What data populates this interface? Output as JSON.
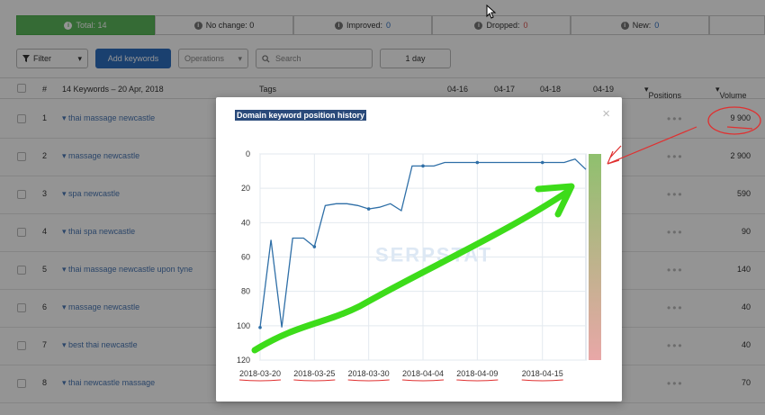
{
  "summary": {
    "total": "Total: 14",
    "no_change": "No change: 0",
    "improved_label": "Improved:",
    "improved_value": "0",
    "dropped_label": "Dropped:",
    "dropped_value": "0",
    "new_label": "New:",
    "new_value": "0"
  },
  "toolbar": {
    "filter": "Filter",
    "add_keywords": "Add keywords",
    "operations": "Operations",
    "search_placeholder": "Search",
    "period": "1 day"
  },
  "table": {
    "headers": {
      "num": "#",
      "keywords": "14 Keywords – 20 Apr, 2018",
      "tags": "Tags",
      "d1": "04-16",
      "d2": "04-17",
      "d3": "04-18",
      "d4": "04-19",
      "positions": "Positions",
      "volume": "Volume"
    },
    "rows": [
      {
        "idx": "1",
        "keyword": "thai massage newcastle",
        "volume": "9 900"
      },
      {
        "idx": "2",
        "keyword": "massage newcastle",
        "volume": "2 900"
      },
      {
        "idx": "3",
        "keyword": "spa newcastle",
        "volume": "590"
      },
      {
        "idx": "4",
        "keyword": "thai spa newcastle",
        "volume": "90"
      },
      {
        "idx": "5",
        "keyword": "thai massage newcastle upon tyne",
        "volume": "140"
      },
      {
        "idx": "6",
        "keyword": "massage newcastle",
        "volume": "40"
      },
      {
        "idx": "7",
        "keyword": "best thai newcastle",
        "volume": "40"
      },
      {
        "idx": "8",
        "keyword": "thai newcastle massage",
        "volume": "70"
      }
    ]
  },
  "modal": {
    "title": "Domain keyword position history",
    "close": "×",
    "watermark": "SERPSTAT"
  },
  "chart_data": {
    "type": "line",
    "title": "Domain keyword position history",
    "xlabel": "",
    "ylabel": "",
    "x_ticks": [
      "2018-03-20",
      "2018-03-25",
      "2018-03-30",
      "2018-04-04",
      "2018-04-09",
      "2018-04-15"
    ],
    "y_ticks": [
      0,
      20,
      40,
      60,
      80,
      100,
      120
    ],
    "ylim": [
      120,
      0
    ],
    "y_inverted": true,
    "grid": true,
    "x": [
      "2018-03-20",
      "2018-03-21",
      "2018-03-22",
      "2018-03-23",
      "2018-03-24",
      "2018-03-25",
      "2018-03-26",
      "2018-03-27",
      "2018-03-28",
      "2018-03-29",
      "2018-03-30",
      "2018-03-31",
      "2018-04-01",
      "2018-04-02",
      "2018-04-03",
      "2018-04-04",
      "2018-04-05",
      "2018-04-06",
      "2018-04-07",
      "2018-04-08",
      "2018-04-09",
      "2018-04-10",
      "2018-04-11",
      "2018-04-12",
      "2018-04-13",
      "2018-04-14",
      "2018-04-15",
      "2018-04-16",
      "2018-04-17",
      "2018-04-18",
      "2018-04-19"
    ],
    "values": [
      101,
      50,
      101,
      49,
      49,
      54,
      30,
      29,
      29,
      30,
      32,
      31,
      29,
      33,
      7,
      7,
      7,
      5,
      5,
      5,
      5,
      5,
      5,
      5,
      5,
      5,
      5,
      5,
      5,
      3,
      9
    ],
    "markers": [
      "2018-03-20",
      "2018-03-25",
      "2018-03-30",
      "2018-04-04",
      "2018-04-09",
      "2018-04-15"
    ],
    "line_color": "#2f6fa7",
    "band_color_top": "#8fc06e",
    "band_color_bottom": "#e8a7a7"
  },
  "colors": {
    "accent": "#2d6ec0",
    "success": "#5cb85c",
    "annotation_green": "#3ddc1a",
    "annotation_red": "#e03030"
  }
}
